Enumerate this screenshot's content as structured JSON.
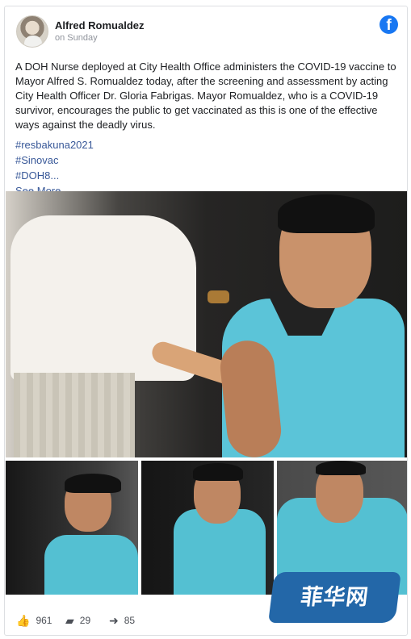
{
  "post": {
    "author": "Alfred Romualdez",
    "time": "on Sunday",
    "text": "A DOH Nurse deployed at City Health Office administers the COVID-19 vaccine to Mayor Alfred S. Romualdez today, after the screening and assessment by acting City Health Officer Dr. Gloria Fabrigas. Mayor Romualdez, who is a COVID-19 survivor, encourages the public to get vaccinated as this is one of the effective ways against the deadly virus.",
    "hashtags": [
      "#resbakuna2021",
      "#Sinovac",
      "#DOH8..."
    ],
    "see_more": "See More"
  },
  "icons": {
    "brand": "facebook-icon",
    "like": "thumbs-up-icon",
    "comment": "comment-icon",
    "share": "share-icon"
  },
  "stats": {
    "likes": "961",
    "comments": "29",
    "shares": "85"
  },
  "watermark": {
    "text": "菲华网"
  },
  "colors": {
    "facebook_blue": "#1877f2",
    "link_blue": "#385898",
    "watermark_blue": "#2367a8"
  }
}
